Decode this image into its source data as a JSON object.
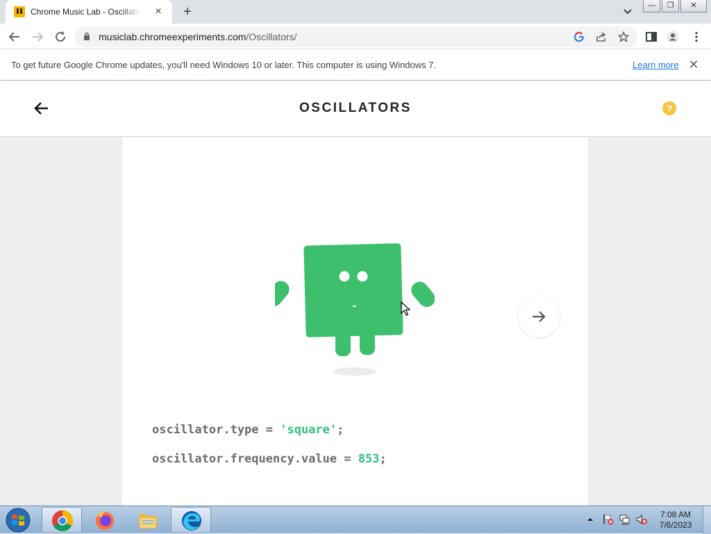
{
  "browser": {
    "tab_title": "Chrome Music Lab - Oscillators",
    "tab_close_icon": "×",
    "new_tab_icon": "+",
    "window_buttons": {
      "minimize": "—",
      "maximize": "❐",
      "close": "✕"
    },
    "url_host": "musiclab.chromeexperiments.com",
    "url_path": "/Oscillators/"
  },
  "infobar": {
    "message": "To get future Google Chrome updates, you'll need Windows 10 or later. This computer is using Windows 7.",
    "link": "Learn more",
    "close_icon": "✕"
  },
  "app": {
    "title": "OSCILLATORS",
    "help_icon_text": "?",
    "character_color": "#3dbf6e",
    "code_line1_prefix": "oscillator.type = ",
    "code_line1_value": "'square'",
    "code_line1_suffix": ";",
    "code_line2_prefix": "oscillator.frequency.value = ",
    "code_line2_value": "853",
    "code_line2_suffix": ";"
  },
  "taskbar": {
    "apps": [
      "chrome-icon",
      "firefox-icon",
      "file-explorer-icon",
      "edge-icon"
    ],
    "time": "7:08 AM",
    "date": "7/6/2023"
  },
  "colors": {
    "accent_green": "#2ec27e",
    "help_yellow": "#f6c342",
    "link_blue": "#1a73e8"
  }
}
